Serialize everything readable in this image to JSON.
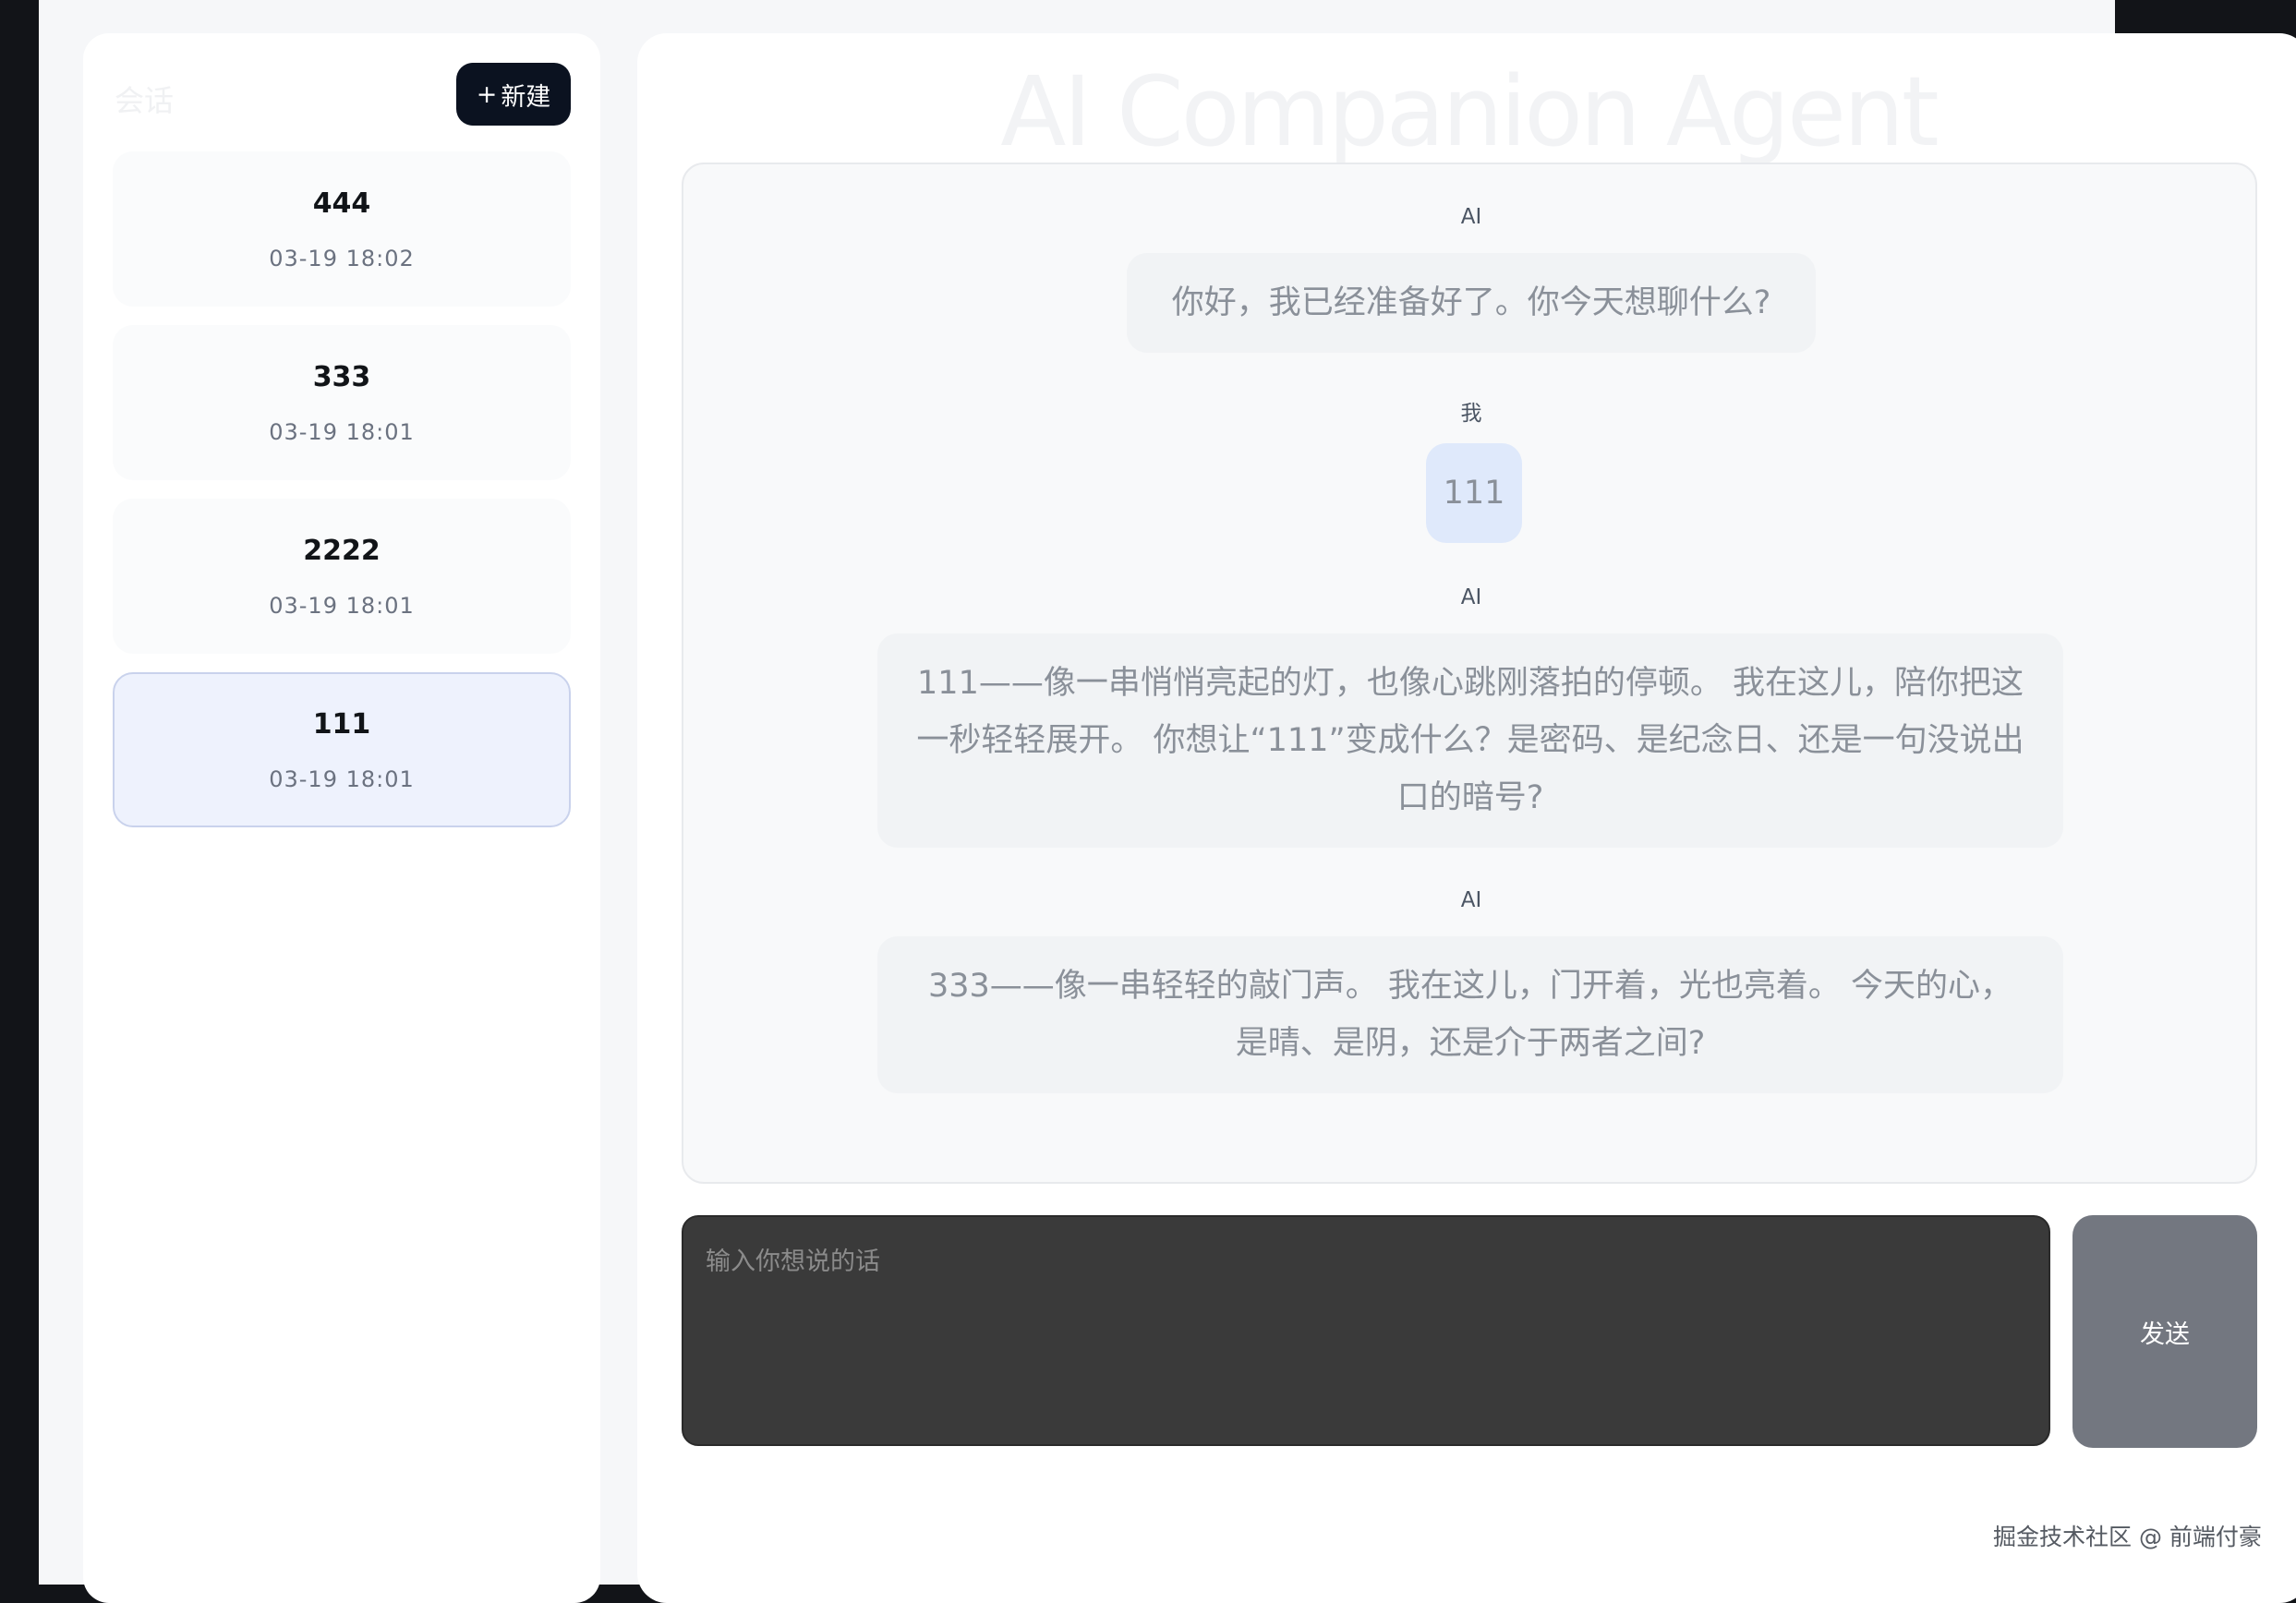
{
  "sidebar": {
    "title": "会话",
    "new_label": "新建",
    "sessions": [
      {
        "name": "444",
        "time": "03-19 18:02"
      },
      {
        "name": "333",
        "time": "03-19 18:01"
      },
      {
        "name": "2222",
        "time": "03-19 18:01"
      },
      {
        "name": "111",
        "time": "03-19 18:01"
      }
    ],
    "active_session": "111"
  },
  "main": {
    "title": "AI Companion Agent",
    "messages": [
      {
        "sender": "AI",
        "text": "你好，我已经准备好了。你今天想聊什么?"
      },
      {
        "sender": "我",
        "text": "111"
      },
      {
        "sender": "AI",
        "lines": [
          "111——像一串悄悄亮起的灯，也像心跳刚落拍的停顿。 我在这儿，陪你把这",
          "一秒轻轻展开。 你想让“111”变成什么？是密码、是纪念日、还是一句没说出",
          "口的暗号?"
        ]
      },
      {
        "sender": "AI",
        "lines": [
          "333——像一串轻轻的敲门声。 我在这儿，门开着，光也亮着。 今天的心，",
          "是晴、是阴，还是介于两者之间?"
        ]
      }
    ],
    "input_placeholder": "输入你想说的话",
    "send_label": "发送"
  },
  "watermark": "掘金技术社区 @ 前端付豪",
  "colors": {
    "new_button_bg": "#0b1220",
    "active_session_bg": "#eef2fd",
    "user_bubble_bg": "#dfe9fb",
    "input_bg": "#3a3a3a",
    "send_button_bg": "#737780"
  }
}
